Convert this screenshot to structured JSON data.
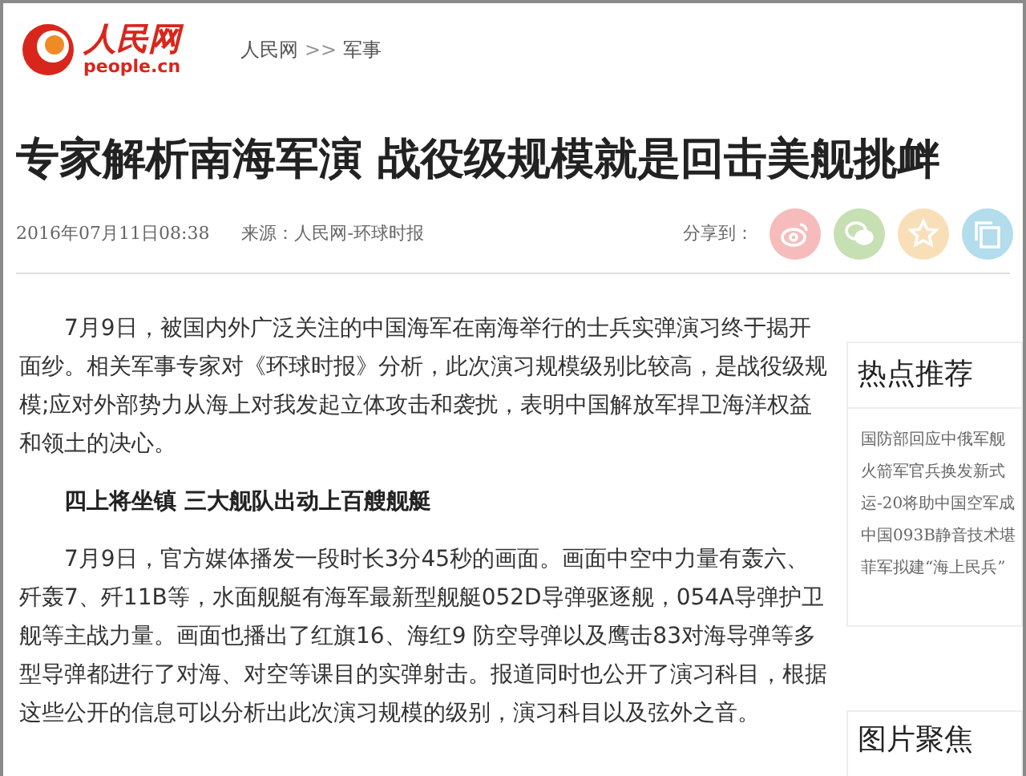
{
  "logo": {
    "name": "人民网",
    "domain": "people.cn"
  },
  "breadcrumb": [
    "人民网",
    "军事"
  ],
  "breadcrumb_separator": ">>",
  "headline": "专家解析南海军演 战役级规模就是回击美舰挑衅",
  "meta": {
    "date": "2016年07月11日08:38",
    "source": "来源：人民网-环球时报",
    "share_label": "分享到："
  },
  "share_buttons": [
    {
      "kind": "weibo",
      "color": "#f6bcbc"
    },
    {
      "kind": "wechat",
      "color": "#c6e0b4"
    },
    {
      "kind": "favorite",
      "color": "#f9dfb8"
    },
    {
      "kind": "copy",
      "color": "#b3dcec"
    }
  ],
  "article": [
    {
      "kind": "paragraph",
      "text": "7月9日，被国内外广泛关注的中国海军在南海举行的士兵实弹演习终于揭开面纱。相关军事专家对《环球时报》分析，此次演习规模级别比较高，是战役级规模;应对外部势力从海上对我发起立体攻击和袭扰，表明中国解放军捍卫海洋权益和领土的决心。"
    },
    {
      "kind": "heading",
      "text": "四上将坐镇 三大舰队出动上百艘舰艇"
    },
    {
      "kind": "paragraph",
      "text": "7月9日，官方媒体播发一段时长3分45秒的画面。画面中空中力量有轰六、歼轰7、歼11B等，水面舰艇有海军最新型舰艇052D导弹驱逐舰，054A导弹护卫舰等主战力量。画面也播出了红旗16、海红9 防空导弹以及鹰击83对海导弹等多型导弹都进行了对海、对空等课目的实弹射击。报道同时也公开了演习科目，根据这些公开的信息可以分析出此次演习规模的级别，演习科目以及弦外之音。"
    }
  ],
  "sidebar": {
    "hot_title": "热点推荐",
    "hot_items": [
      "国防部回应中俄军舰",
      "火箭军官兵换发新式",
      "运-20将助中国空军成",
      "中国093B静音技术堪",
      "菲军拟建“海上民兵”"
    ],
    "photo_title": "图片聚焦"
  }
}
